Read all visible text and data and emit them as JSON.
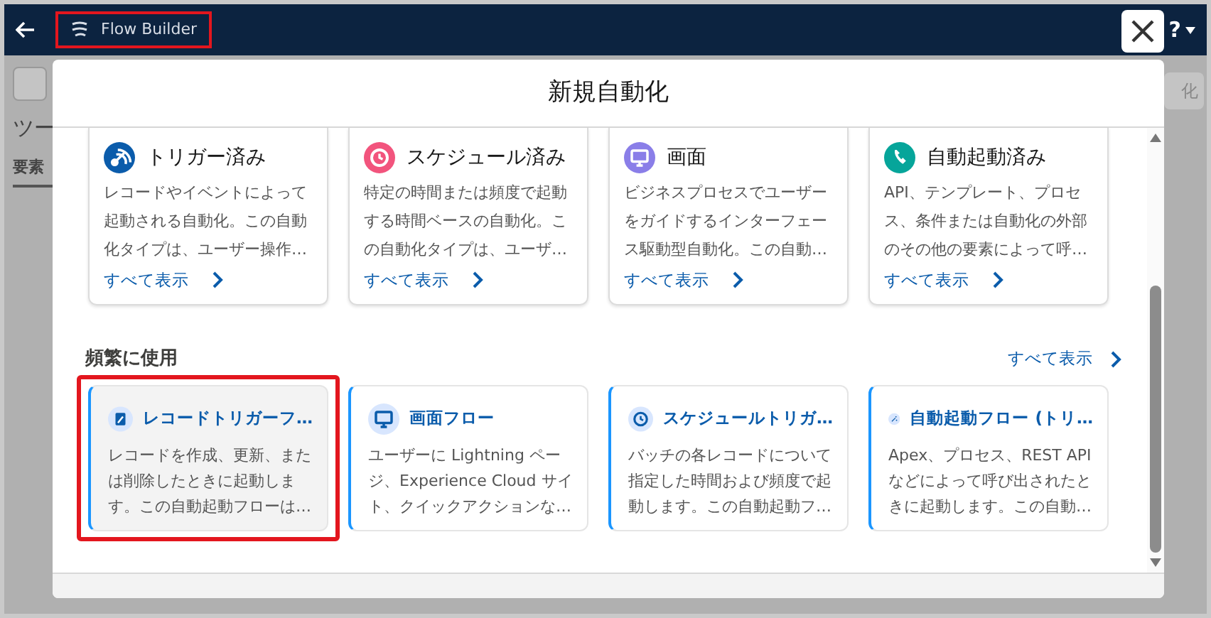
{
  "app_bar": {
    "title": "Flow Builder",
    "highlighted": true,
    "help": "?"
  },
  "background": {
    "toolbar_text": "化",
    "panel_tab": "ツー",
    "panel_item": "要素"
  },
  "modal": {
    "title": "新規自動化",
    "categories": [
      {
        "kind": "trigger",
        "color": "#0b5cab",
        "title": "トリガー済み",
        "description": "レコードやイベントによって起動される自動化。この自動化タイプは、ユーザー操作…",
        "link": "すべて表示"
      },
      {
        "kind": "schedule",
        "color": "#f2547d",
        "title": "スケジュール済み",
        "description": "特定の時間または頻度で起動する時間ベースの自動化。この自動化タイプは、ユーザ…",
        "link": "すべて表示"
      },
      {
        "kind": "screen",
        "color": "#8a7ee8",
        "title": "画面",
        "description": "ビジネスプロセスでユーザーをガイドするインターフェース駆動型自動化。この自動…",
        "link": "すべて表示"
      },
      {
        "kind": "autolaunch",
        "color": "#06a59a",
        "title": "自動起動済み",
        "description": "API、テンプレート、プロセス、条件または自動化の外部のその他の要素によって呼…",
        "link": "すべて表示"
      }
    ],
    "frequent": {
      "heading": "頻繁に使用",
      "link": "すべて表示",
      "items": [
        {
          "kind": "record",
          "title": "レコードトリガーフ…",
          "description": "レコードを作成、更新、または削除したときに起動します。この自動起動フローは…",
          "selected": true,
          "highlighted": true
        },
        {
          "kind": "screen",
          "title": "画面フロー",
          "description": "ユーザーに Lightning ページ、Experience Cloud サイト、クイックアクションな…",
          "selected": false,
          "highlighted": false
        },
        {
          "kind": "schedule",
          "title": "スケジュールトリガ…",
          "description": "バッチの各レコードについて指定した時間および頻度で起動します。この自動起動フ…",
          "selected": false,
          "highlighted": false
        },
        {
          "kind": "autolaunch",
          "title": "自動起動フロー (トリ…",
          "description": "Apex、プロセス、REST API などによって呼び出されたときに起動します。この自動…",
          "selected": false,
          "highlighted": false
        }
      ]
    }
  }
}
